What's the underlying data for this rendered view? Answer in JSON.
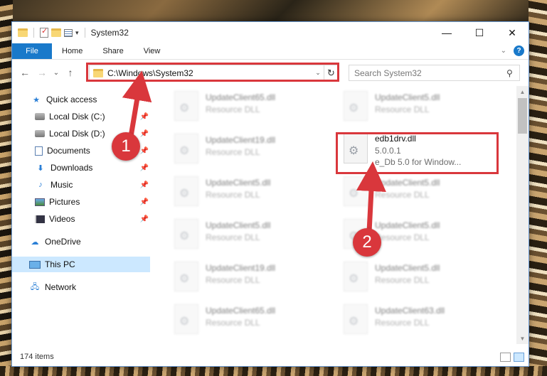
{
  "window": {
    "title": "System32",
    "controls": {
      "minimize": "—",
      "maximize": "☐",
      "close": "✕"
    }
  },
  "ribbon": {
    "tabs": [
      "File",
      "Home",
      "Share",
      "View"
    ],
    "help": "?"
  },
  "navigation": {
    "back": "←",
    "forward": "→",
    "recent": "⌄",
    "up": "↑",
    "address": "C:\\Windows\\System32",
    "search_placeholder": "Search System32"
  },
  "sidebar": {
    "items": [
      {
        "label": "Quick access",
        "icon": "star-icon",
        "pinned": false
      },
      {
        "label": "Local Disk (C:)",
        "icon": "disk-icon",
        "pinned": true
      },
      {
        "label": "Local Disk (D:)",
        "icon": "disk-icon",
        "pinned": true
      },
      {
        "label": "Documents",
        "icon": "documents-icon",
        "pinned": true
      },
      {
        "label": "Downloads",
        "icon": "download-icon",
        "pinned": true
      },
      {
        "label": "Music",
        "icon": "music-icon",
        "pinned": true
      },
      {
        "label": "Pictures",
        "icon": "pictures-icon",
        "pinned": true
      },
      {
        "label": "Videos",
        "icon": "videos-icon",
        "pinned": true
      },
      {
        "label": "OneDrive",
        "icon": "cloud-icon",
        "pinned": false
      },
      {
        "label": "This PC",
        "icon": "pc-icon",
        "pinned": false,
        "selected": true
      },
      {
        "label": "Network",
        "icon": "network-icon",
        "pinned": false
      }
    ]
  },
  "files": {
    "left_column": [
      {
        "name": "UpdateClient65.dll",
        "type": "Resource DLL"
      },
      {
        "name": "UpdateClient19.dll",
        "type": "Resource DLL"
      },
      {
        "name": "UpdateClient5.dll",
        "type": "Resource DLL"
      },
      {
        "name": "UpdateClient5.dll",
        "type": "Resource DLL"
      },
      {
        "name": "UpdateClient19.dll",
        "type": "Resource DLL"
      },
      {
        "name": "UpdateClient65.dll",
        "type": "Resource DLL"
      }
    ],
    "right_column": [
      {
        "name": "UpdateClient5.dll",
        "type": "Resource DLL"
      },
      {
        "name": "edb1drv.dll",
        "type": "5.0.0.1",
        "description": "e_Db 5.0 for Window...",
        "highlighted": true
      },
      {
        "name": "UpdateClient5.dll",
        "type": "Resource DLL"
      },
      {
        "name": "UpdateClient5.dll",
        "type": "Resource DLL"
      },
      {
        "name": "UpdateClient5.dll",
        "type": "Resource DLL"
      },
      {
        "name": "UpdateClient63.dll",
        "type": "Resource DLL"
      }
    ]
  },
  "status": {
    "item_count": "174 items"
  },
  "callouts": {
    "first": "1",
    "second": "2"
  },
  "colors": {
    "accent": "#1979ca",
    "highlight": "#d9373c",
    "selection": "#cce8ff"
  }
}
